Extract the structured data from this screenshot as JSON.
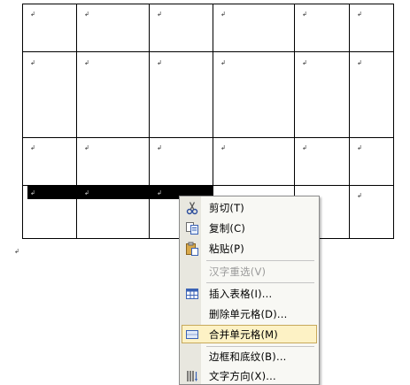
{
  "cell_mark": "↲",
  "paragraph_mark": "↲",
  "context_menu": {
    "items": [
      {
        "label": "剪切(T)",
        "icon": "scissors-icon",
        "enabled": true
      },
      {
        "label": "复制(C)",
        "icon": "copy-icon",
        "enabled": true
      },
      {
        "label": "粘贴(P)",
        "icon": "paste-icon",
        "enabled": true
      },
      {
        "label": "汉字重选(V)",
        "icon": "",
        "enabled": false
      },
      {
        "label": "插入表格(I)...",
        "icon": "insert-table-icon",
        "enabled": true
      },
      {
        "label": "删除单元格(D)...",
        "icon": "",
        "enabled": true
      },
      {
        "label": "合并单元格(M)",
        "icon": "merge-cells-icon",
        "enabled": true,
        "highlighted": true
      },
      {
        "label": "边框和底纹(B)...",
        "icon": "",
        "enabled": true
      },
      {
        "label": "文字方向(X)...",
        "icon": "text-direction-icon",
        "enabled": true
      }
    ]
  }
}
